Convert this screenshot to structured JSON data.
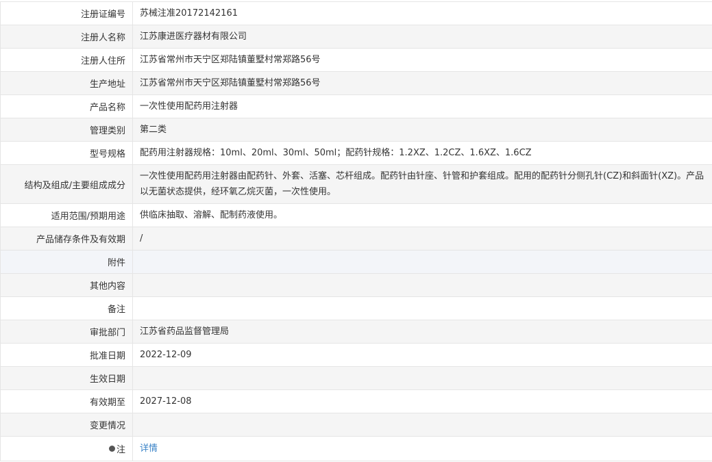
{
  "record": {
    "registration_number": {
      "label": "注册证编号",
      "value": "苏械注准20172142161"
    },
    "registrant_name": {
      "label": "注册人名称",
      "value": "江苏康进医疗器材有限公司"
    },
    "registrant_address": {
      "label": "注册人住所",
      "value": "江苏省常州市天宁区郑陆镇董墅村常郑路56号"
    },
    "production_address": {
      "label": "生产地址",
      "value": "江苏省常州市天宁区郑陆镇董墅村常郑路56号"
    },
    "product_name": {
      "label": "产品名称",
      "value": "一次性使用配药用注射器"
    },
    "management_category": {
      "label": "管理类别",
      "value": "第二类"
    },
    "model_spec": {
      "label": "型号规格",
      "value": "配药用注射器规格：10ml、20ml、30ml、50ml；配药针规格：1.2XZ、1.2CZ、1.6XZ、1.6CZ"
    },
    "structure": {
      "label": "结构及组成/主要组成成分",
      "value": "一次性使用配药用注射器由配药针、外套、活塞、芯杆组成。配药针由针座、针管和护套组成。配用的配药针分侧孔针(CZ)和斜面针(XZ)。产品以无菌状态提供，经环氧乙烷灭菌，一次性使用。"
    },
    "scope": {
      "label": "适用范围/预期用途",
      "value": "供临床抽取、溶解、配制药液使用。"
    },
    "storage": {
      "label": "产品储存条件及有效期",
      "value": "/"
    },
    "attachment": {
      "label": "附件",
      "value": ""
    },
    "other": {
      "label": "其他内容",
      "value": ""
    },
    "remark": {
      "label": "备注",
      "value": ""
    },
    "approval_dept": {
      "label": "审批部门",
      "value": "江苏省药品监督管理局"
    },
    "approval_date": {
      "label": "批准日期",
      "value": "2022-12-09"
    },
    "effective_date": {
      "label": "生效日期",
      "value": ""
    },
    "valid_until": {
      "label": "有效期至",
      "value": "2027-12-08"
    },
    "changes": {
      "label": "变更情况",
      "value": ""
    },
    "note": {
      "label": "注",
      "icon": "bullet-icon",
      "link_text": "详情"
    }
  }
}
